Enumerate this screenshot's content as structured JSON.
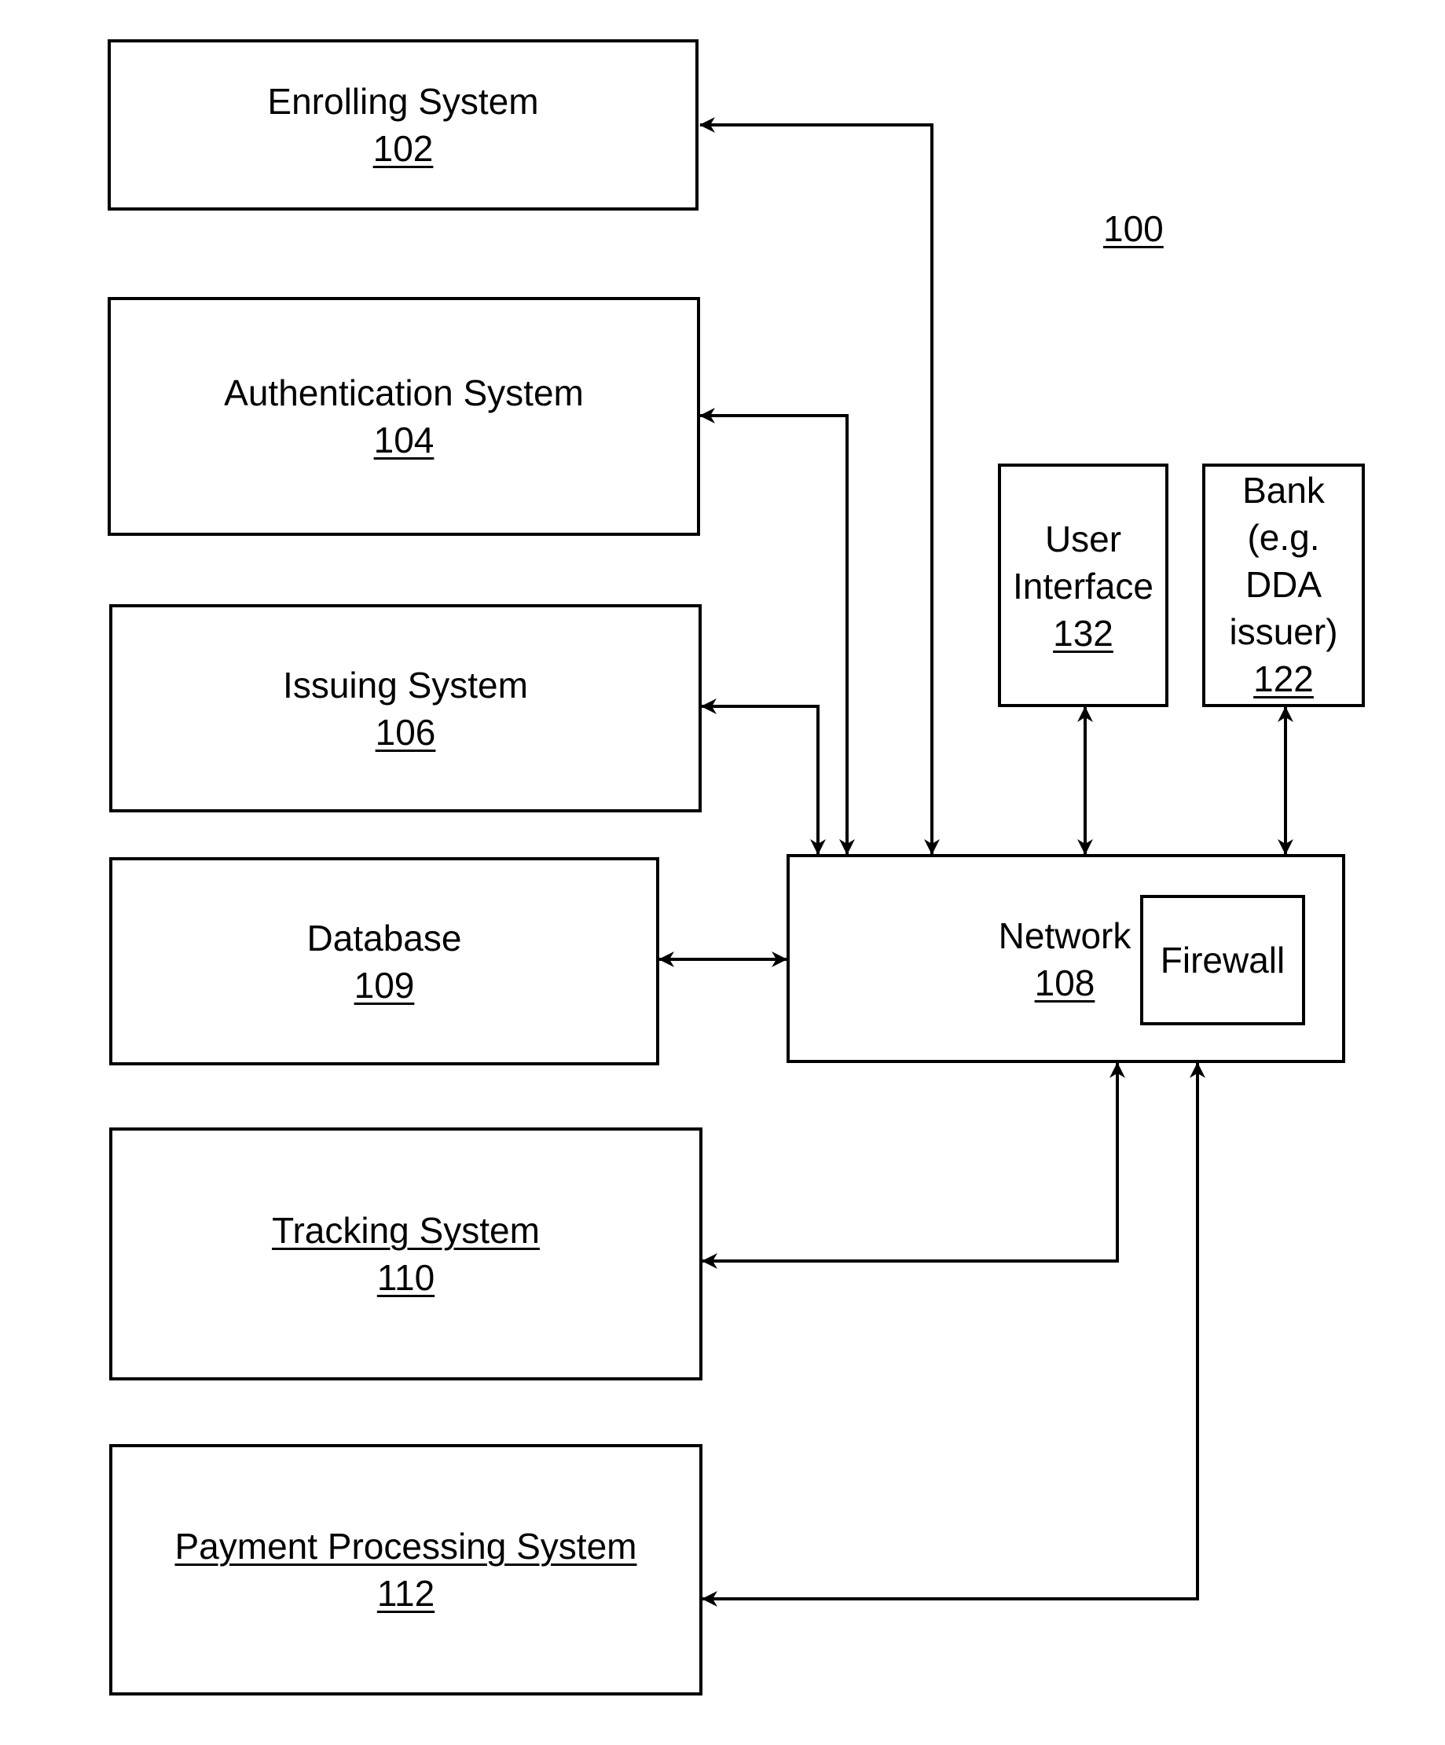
{
  "figure_number": "100",
  "boxes": {
    "enrolling": {
      "title": "Enrolling System",
      "number": "102"
    },
    "authentication": {
      "title": "Authentication System",
      "number": "104"
    },
    "issuing": {
      "title": "Issuing System",
      "number": "106"
    },
    "database": {
      "title": "Database",
      "number": "109"
    },
    "tracking": {
      "title": "Tracking System",
      "number": "110"
    },
    "payment": {
      "title": "Payment Processing System",
      "number": "112"
    },
    "user_interface": {
      "line1": "User",
      "line2": "Interface",
      "number": "132"
    },
    "bank": {
      "line1": "Bank",
      "line2": "(e.g.",
      "line3": "DDA",
      "line4": "issuer)",
      "number": "122"
    },
    "network": {
      "title": "Network",
      "number": "108"
    },
    "firewall": {
      "title": "Firewall"
    }
  },
  "connections": [
    {
      "from": "network",
      "to": "enrolling",
      "type": "bidirectional"
    },
    {
      "from": "network",
      "to": "authentication",
      "type": "bidirectional"
    },
    {
      "from": "network",
      "to": "issuing",
      "type": "bidirectional"
    },
    {
      "from": "network",
      "to": "database",
      "type": "bidirectional"
    },
    {
      "from": "network",
      "to": "user_interface",
      "type": "bidirectional"
    },
    {
      "from": "network",
      "to": "bank",
      "type": "bidirectional"
    },
    {
      "from": "network",
      "to": "tracking",
      "type": "bidirectional"
    },
    {
      "from": "network",
      "to": "payment",
      "type": "bidirectional"
    }
  ]
}
